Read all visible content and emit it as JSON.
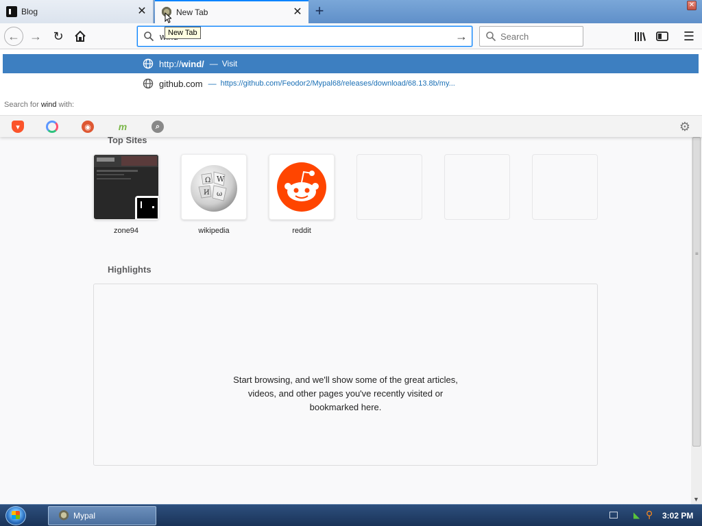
{
  "tabs": [
    {
      "title": "Blog",
      "active": false
    },
    {
      "title": "New Tab",
      "active": true
    }
  ],
  "tooltip": "New Tab",
  "urlbar": {
    "value": "wind",
    "placeholder": ""
  },
  "searchbar": {
    "placeholder": "Search"
  },
  "url_results": [
    {
      "title_prefix": "http://",
      "title_bold": "wind/",
      "separator": "—",
      "action": "Visit"
    },
    {
      "title": "github.com",
      "separator": "—",
      "url": "https://github.com/Feodor2/Mypal68/releases/download/68.13.8b/my..."
    }
  ],
  "search_for": {
    "prefix": "Search for",
    "term": "wind",
    "suffix": "with:"
  },
  "engines": [
    "brave",
    "qwant",
    "duckduckgo",
    "mojeek",
    "search"
  ],
  "top_sites": {
    "title": "Top Sites",
    "tiles": [
      {
        "label": "zone94"
      },
      {
        "label": "wikipedia"
      },
      {
        "label": "reddit"
      }
    ]
  },
  "highlights": {
    "title": "Highlights",
    "empty_lines": [
      "Start browsing, and we'll show some of the great articles,",
      "videos, and other pages you've recently visited or",
      "bookmarked here."
    ]
  },
  "taskbar": {
    "items": [
      {
        "label": "Mypal"
      }
    ],
    "clock": "3:02 PM"
  },
  "colors": {
    "accent": "#0a84ff",
    "selected_result": "#3d7fc1",
    "reddit": "#ff4500"
  }
}
